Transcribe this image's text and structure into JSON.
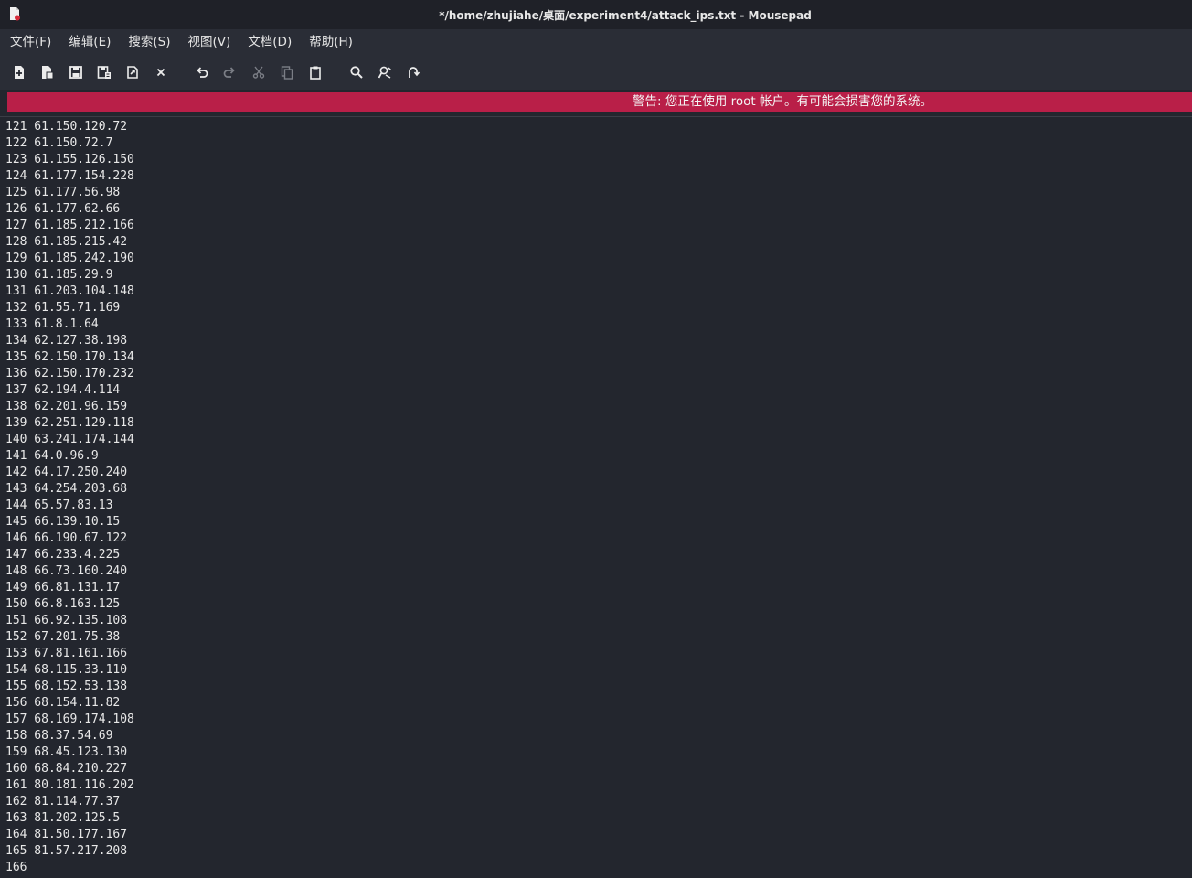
{
  "window": {
    "title": "*/home/zhujiahe/桌面/experiment4/attack_ips.txt - Mousepad"
  },
  "menubar": {
    "items": [
      {
        "label": "文件(F)"
      },
      {
        "label": "编辑(E)"
      },
      {
        "label": "搜索(S)"
      },
      {
        "label": "视图(V)"
      },
      {
        "label": "文档(D)"
      },
      {
        "label": "帮助(H)"
      }
    ]
  },
  "toolbar": {
    "buttons": [
      {
        "icon": "new-document-icon"
      },
      {
        "icon": "new-window-icon"
      },
      {
        "icon": "save-icon"
      },
      {
        "icon": "save-as-icon"
      },
      {
        "icon": "reload-icon"
      },
      {
        "icon": "close-icon"
      },
      {
        "icon": "undo-icon"
      },
      {
        "icon": "redo-icon"
      },
      {
        "icon": "cut-icon"
      },
      {
        "icon": "copy-icon"
      },
      {
        "icon": "paste-icon"
      },
      {
        "icon": "find-icon"
      },
      {
        "icon": "find-replace-icon"
      },
      {
        "icon": "goto-line-icon"
      }
    ]
  },
  "warning": {
    "text": "警告: 您正在使用 root 帐户。有可能会损害您的系统。",
    "color": "#b91f48"
  },
  "editor": {
    "lines": [
      "121 61.150.120.72",
      "122 61.150.72.7",
      "123 61.155.126.150",
      "124 61.177.154.228",
      "125 61.177.56.98",
      "126 61.177.62.66",
      "127 61.185.212.166",
      "128 61.185.215.42",
      "129 61.185.242.190",
      "130 61.185.29.9",
      "131 61.203.104.148",
      "132 61.55.71.169",
      "133 61.8.1.64",
      "134 62.127.38.198",
      "135 62.150.170.134",
      "136 62.150.170.232",
      "137 62.194.4.114",
      "138 62.201.96.159",
      "139 62.251.129.118",
      "140 63.241.174.144",
      "141 64.0.96.9",
      "142 64.17.250.240",
      "143 64.254.203.68",
      "144 65.57.83.13",
      "145 66.139.10.15",
      "146 66.190.67.122",
      "147 66.233.4.225",
      "148 66.73.160.240",
      "149 66.81.131.17",
      "150 66.8.163.125",
      "151 66.92.135.108",
      "152 67.201.75.38",
      "153 67.81.161.166",
      "154 68.115.33.110",
      "155 68.152.53.138",
      "156 68.154.11.82",
      "157 68.169.174.108",
      "158 68.37.54.69",
      "159 68.45.123.130",
      "160 68.84.210.227",
      "161 80.181.116.202",
      "162 81.114.77.37",
      "163 81.202.125.5",
      "164 81.50.177.167",
      "165 81.57.217.208",
      "166"
    ]
  }
}
